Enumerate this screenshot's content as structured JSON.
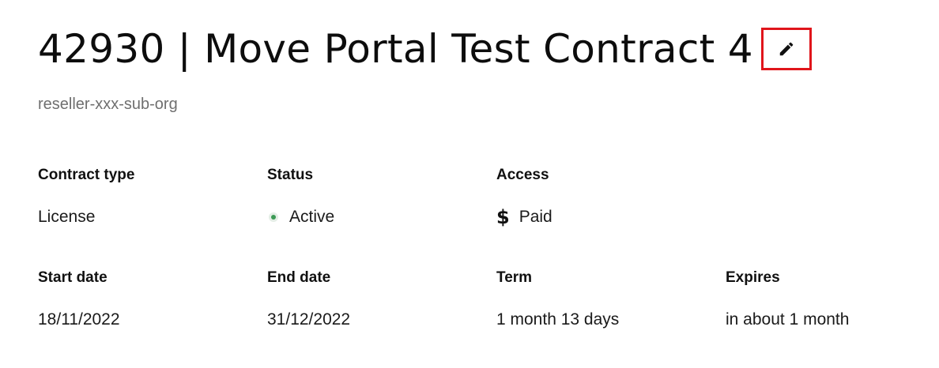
{
  "contract": {
    "title": "42930 | Move Portal Test Contract 4",
    "organization": "reseller-xxx-sub-org",
    "edit_icon": "pencil-icon",
    "accent_color": "#e0151b"
  },
  "fields": {
    "contract_type": {
      "label": "Contract type",
      "value": "License"
    },
    "status": {
      "label": "Status",
      "value": "Active",
      "icon": "status-dot-icon",
      "color": "#3c9a55"
    },
    "access": {
      "label": "Access",
      "value": "Paid",
      "icon": "dollar-icon",
      "symbol": "$"
    },
    "start_date": {
      "label": "Start date",
      "value": "18/11/2022"
    },
    "end_date": {
      "label": "End date",
      "value": "31/12/2022"
    },
    "term": {
      "label": "Term",
      "value": "1 month 13 days"
    },
    "expires": {
      "label": "Expires",
      "value": "in about 1 month"
    }
  }
}
